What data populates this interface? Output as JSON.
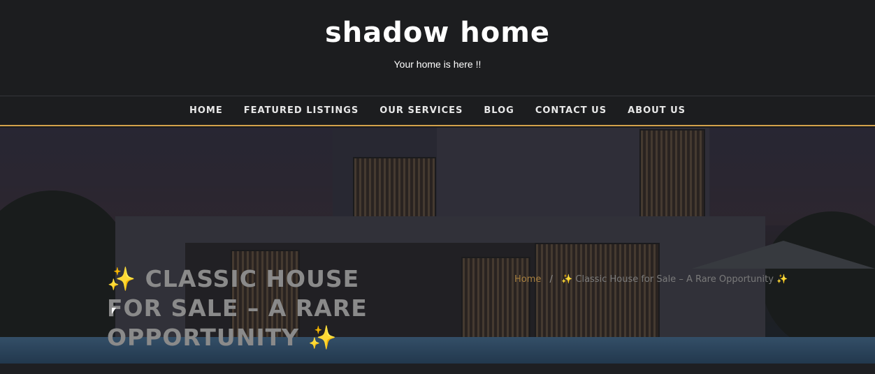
{
  "header": {
    "site_title": "shadow home",
    "tagline": "Your home is here !!"
  },
  "nav": {
    "items": [
      {
        "label": "HOME"
      },
      {
        "label": "FEATURED LISTINGS"
      },
      {
        "label": "OUR SERVICES"
      },
      {
        "label": "BLOG"
      },
      {
        "label": "CONTACT US"
      },
      {
        "label": "ABOUT US"
      }
    ]
  },
  "hero": {
    "title_prefix_icon": "✨",
    "title": "CLASSIC HOUSE FOR SALE – A RARE OPPORTUNITY",
    "title_suffix_icon": "✨",
    "breadcrumb": {
      "home": "Home",
      "separator": "/",
      "current": "✨ Classic House for Sale – A Rare Opportunity ✨"
    }
  },
  "colors": {
    "background": "#1c1d1f",
    "accent": "#d4a24c",
    "text": "#ffffff"
  }
}
